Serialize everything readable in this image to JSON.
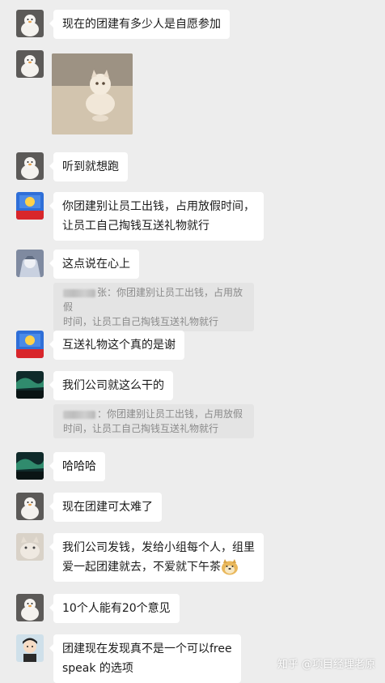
{
  "messages": [
    {
      "avatar": "white-duck-avatar",
      "text": "现在的团建有多少人是自愿参加"
    },
    {
      "avatar": "white-duck-avatar",
      "image": "running-kitten-photo"
    },
    {
      "avatar": "white-duck-avatar",
      "text": "听到就想跑"
    },
    {
      "avatar": "guangzhou-badge-avatar",
      "badge_text": "广州加油",
      "line1": "你团建别让员工出钱，占用放假时间，",
      "line2": "让员工自己掏钱互送礼物就行"
    },
    {
      "avatar": "anime-character-avatar",
      "text": "这点说在心上",
      "quote": {
        "suffix": "张：你团建别让员工出钱，占用放假",
        "line2": "时间，让员工自己掏钱互送礼物就行"
      }
    },
    {
      "avatar": "guangzhou-badge-avatar",
      "badge_text": "广州加油",
      "text": "互送礼物这个真的是谢"
    },
    {
      "avatar": "aurora-landscape-avatar",
      "text": "我们公司就这么干的",
      "quote": {
        "suffix": "：你团建别让员工出钱，占用放假",
        "line2": "时间，让员工自己掏钱互送礼物就行"
      }
    },
    {
      "avatar": "aurora-landscape-avatar",
      "text": "哈哈哈"
    },
    {
      "avatar": "white-duck-avatar",
      "text": "现在团建可太难了"
    },
    {
      "avatar": "cat-avatar",
      "line1": "我们公司发钱，发给小组每个人，组里",
      "line2": "爱一起团建就去，不爱就下午茶"
    },
    {
      "avatar": "white-duck-avatar",
      "text": "10个人能有20个意见"
    },
    {
      "avatar": "cartoon-person-avatar",
      "line1": "团建现在发现真不是一个可以free",
      "line2": "speak 的选项"
    }
  ],
  "watermark": "知乎 @项目经理老原"
}
